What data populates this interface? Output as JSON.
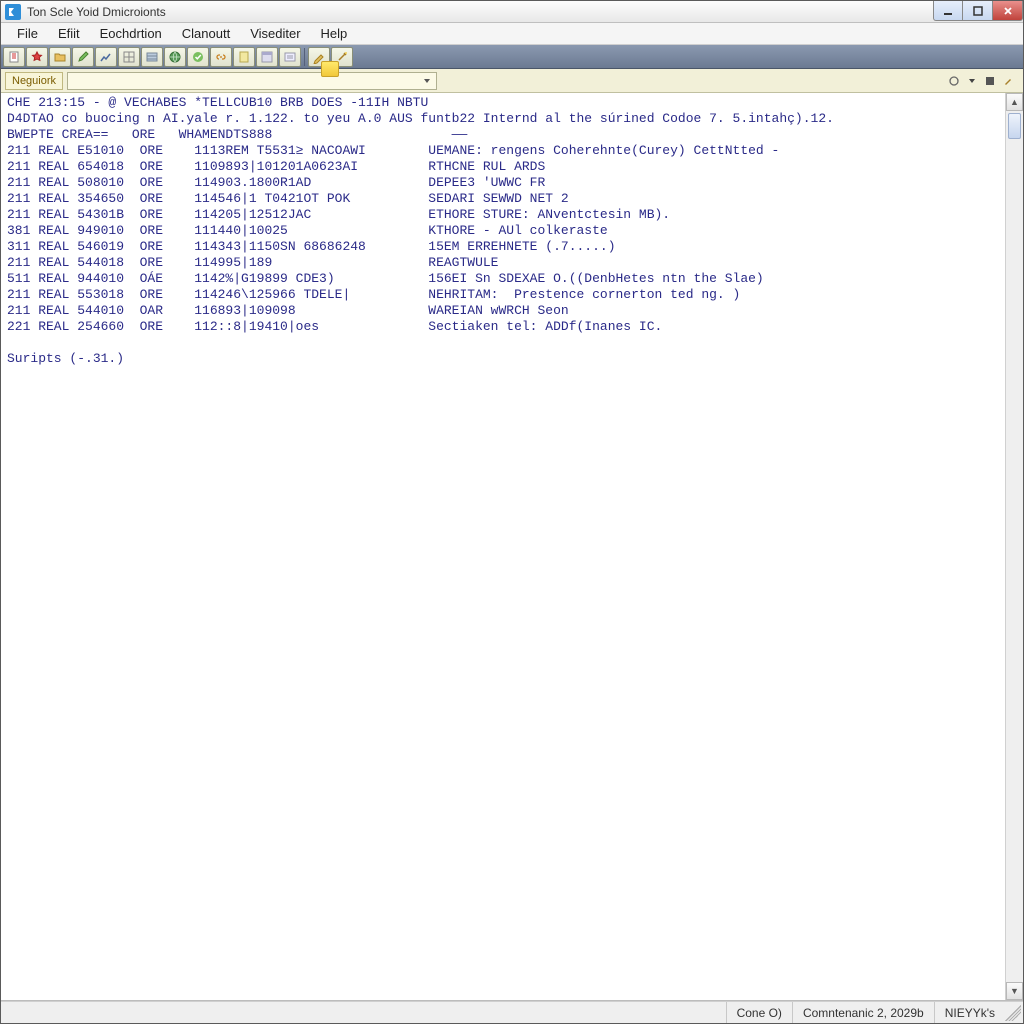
{
  "window": {
    "title": "Ton Scle Yoid Dmicroionts"
  },
  "menu": {
    "items": [
      "File",
      "Efiit",
      "Eochdrtion",
      "Clanoutt",
      "Visediter",
      "Help"
    ]
  },
  "toolbar": {
    "icons": [
      "new-file-icon",
      "favorite-icon",
      "folder-icon",
      "edit-icon",
      "chart-icon",
      "grid-icon",
      "table-icon",
      "globe-icon",
      "check-icon",
      "link-icon",
      "sheet-icon",
      "layout-icon",
      "form-icon",
      "pen-icon",
      "wand-icon"
    ]
  },
  "addressbar": {
    "label": "Neguiork",
    "value": ""
  },
  "console": {
    "header1": "CHE 213:15 - @ VECHABES *TELLCUB10 BRB DOES -11IH NBTU",
    "header2": "D4DTAO co buocing n AI.yale r. 1.122. to yeu A.0 AUS funtb22 Internd al the súrined Codoe 7. 5.intahç).12.",
    "columns_line": "BWEPTE CREA==   ORE   WHAMENDTS888                       ——",
    "rows": [
      {
        "c1": "211 REAL E51010  ORE",
        "c2": "1113REM T5531≥ NACOAWI",
        "c3": "UEMANE: rengens Coherehnte(Curey) CettNtted -"
      },
      {
        "c1": "211 REAL 654018  ORE",
        "c2": "1109893|101201A0623AI",
        "c3": "RTHCNE RUL ARDS"
      },
      {
        "c1": "211 REAL 508010  ORE",
        "c2": "114903.1800R1AD",
        "c3": "DEPEE3 'UWWC FR"
      },
      {
        "c1": "211 REAL 354650  ORE",
        "c2": "114546|1 T0421OT POK",
        "c3": "SEDARI SEWWD NET 2"
      },
      {
        "c1": "211 REAL 54301B  ORE",
        "c2": "114205|12512JAC",
        "c3": "ETHORE STURE: ANventctesin MB)."
      },
      {
        "c1": "381 REAL 949010  ORE",
        "c2": "111440|10025",
        "c3": "KTHORE - AUl colkeraste"
      },
      {
        "c1": "311 REAL 546019  ORE",
        "c2": "114343|1150SN 68686248",
        "c3": "15EM ERREHNETE (.7.....)"
      },
      {
        "c1": "211 REAL 544018  ORE",
        "c2": "114995|189",
        "c3": "REAGTWULE"
      },
      {
        "c1": "511 REAL 944010  OÁE",
        "c2": "1142%|G19899 CDE3)",
        "c3": "156EI Sn SDEXAE O.((DenbHetes ntn the Slae)"
      },
      {
        "c1": "211 REAL 553018  ORE",
        "c2": "114246\\125966 TDELE|",
        "c3": "NEHRITAM:  Prestence cornerton ted ng. )"
      },
      {
        "c1": "211 REAL 544010  OAR",
        "c2": "116893|109098",
        "c3": "WAREIAN wWRCH Seon"
      },
      {
        "c1": "221 REAL 254660  ORE",
        "c2": "112::8|19410|oes",
        "c3": "Sectiaken tel: ADDf(Inanes IC."
      }
    ],
    "footer": "Suripts (-.31.)"
  },
  "statusbar": {
    "center": "Cone O)",
    "right1": "Comntenanic 2, 2029b",
    "right2": "NIEYYk's"
  }
}
